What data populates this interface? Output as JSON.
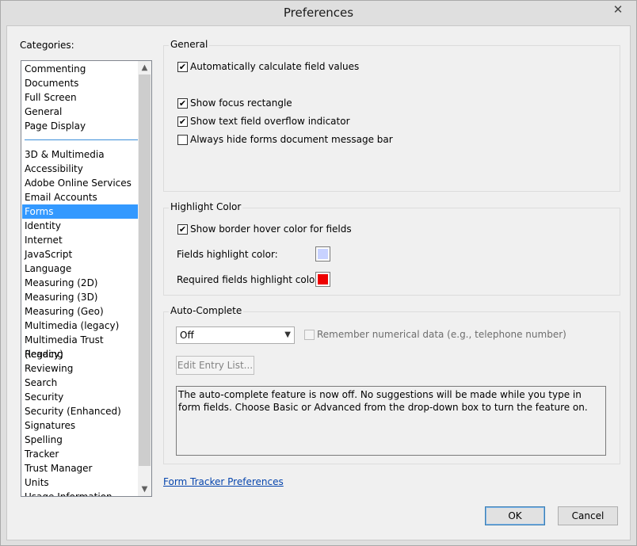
{
  "window": {
    "title": "Preferences",
    "close_glyph": "✕"
  },
  "categories": {
    "label": "Categories:",
    "top_items": [
      "Commenting",
      "Documents",
      "Full Screen",
      "General",
      "Page Display"
    ],
    "items": [
      "3D & Multimedia",
      "Accessibility",
      "Adobe Online Services",
      "Email Accounts",
      "Forms",
      "Identity",
      "Internet",
      "JavaScript",
      "Language",
      "Measuring (2D)",
      "Measuring (3D)",
      "Measuring (Geo)",
      "Multimedia (legacy)",
      "Multimedia Trust (legacy)",
      "Reading",
      "Reviewing",
      "Search",
      "Security",
      "Security (Enhanced)",
      "Signatures",
      "Spelling",
      "Tracker",
      "Trust Manager",
      "Units",
      "Usage Information"
    ],
    "selected": "Forms"
  },
  "general": {
    "title": "General",
    "auto_calc": {
      "label": "Automatically calculate field values",
      "checked": true
    },
    "focus_rect": {
      "label": "Show focus rectangle",
      "checked": true
    },
    "overflow": {
      "label": "Show text field overflow indicator",
      "checked": true
    },
    "hide_bar": {
      "label": "Always hide forms document message bar",
      "checked": false
    }
  },
  "highlight": {
    "title": "Highlight Color",
    "hover": {
      "label": "Show border hover color for fields",
      "checked": true
    },
    "fields_label": "Fields highlight color:",
    "fields_color": "#c8d2ff",
    "required_label": "Required fields highlight color:",
    "required_color": "#ee0000"
  },
  "autocomplete": {
    "title": "Auto-Complete",
    "select_value": "Off",
    "remember": {
      "label": "Remember numerical data (e.g., telephone number)",
      "checked": false
    },
    "edit_button": "Edit Entry List...",
    "description": "The auto-complete feature is now off. No suggestions will be made while you type in form fields. Choose Basic or Advanced from the drop-down box to turn the feature on."
  },
  "tracker_link": "Form Tracker Preferences",
  "buttons": {
    "ok": "OK",
    "cancel": "Cancel"
  },
  "icons": {
    "check": "✔",
    "chevron_down": "⌄",
    "scroll_up": "▲",
    "scroll_down": "▼"
  }
}
